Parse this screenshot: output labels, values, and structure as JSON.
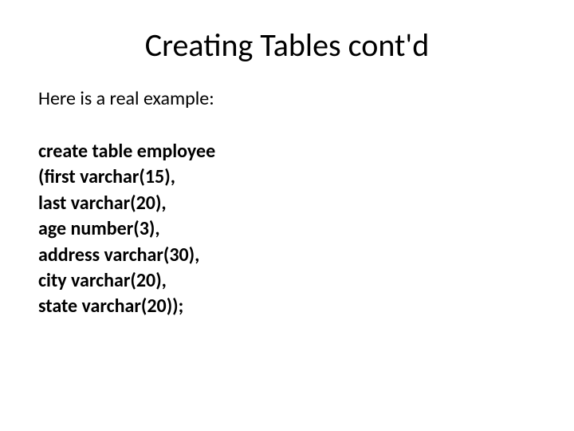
{
  "slide": {
    "title": "Creating Tables cont'd",
    "intro": "Here is a real example:",
    "code": {
      "l1": "create table employee",
      "l2": "(first varchar(15),",
      "l3": "last varchar(20),",
      "l4": "age number(3),",
      "l5": "address varchar(30),",
      "l6": "city varchar(20),",
      "l7": "state varchar(20));"
    }
  }
}
